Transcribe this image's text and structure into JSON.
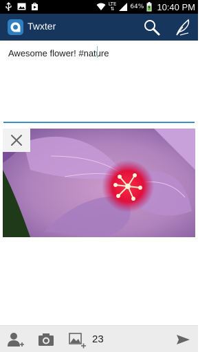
{
  "status_bar": {
    "network": "LTE",
    "battery": "64%",
    "time": "10:40 PM"
  },
  "app_bar": {
    "title": "Twxter"
  },
  "compose": {
    "text": "Awesome flower! #nature"
  },
  "bottom_bar": {
    "char_count": "23"
  },
  "colors": {
    "app_bar": "#17365e",
    "accent": "#3a8fc7",
    "bottom_bar": "#ececec"
  },
  "icons": [
    "search-icon",
    "feather-compose-icon",
    "close-icon",
    "add-user-icon",
    "camera-icon",
    "add-image-icon",
    "send-icon"
  ]
}
